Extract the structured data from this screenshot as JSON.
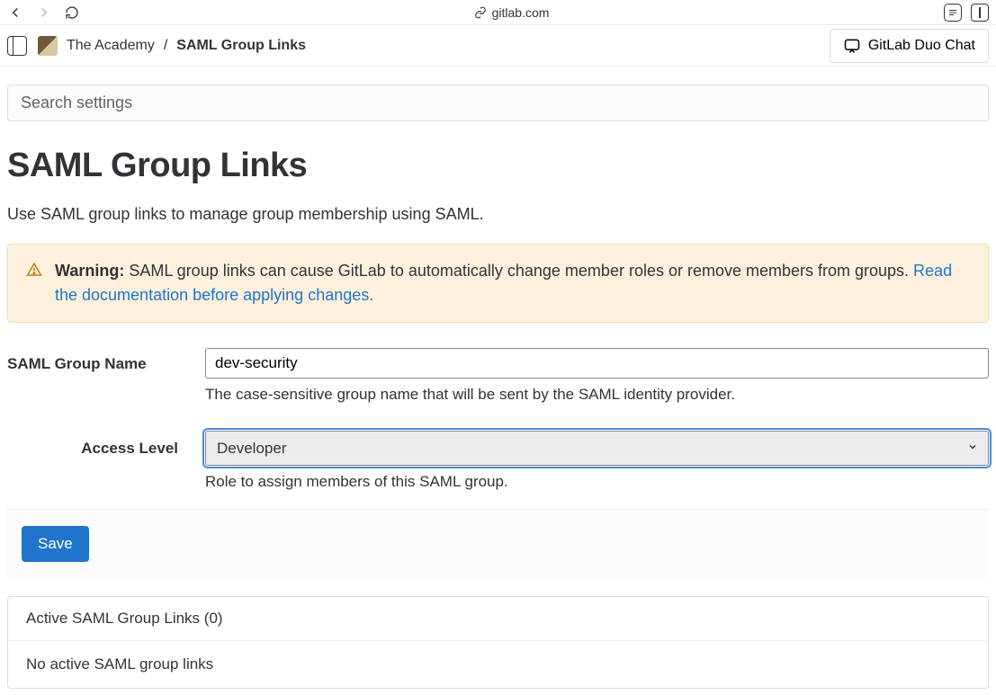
{
  "browser": {
    "domain": "gitlab.com"
  },
  "breadcrumb": {
    "group": "The Academy",
    "sep": "/",
    "current": "SAML Group Links"
  },
  "duo_chat_label": "GitLab Duo Chat",
  "search": {
    "placeholder": "Search settings"
  },
  "page": {
    "title": "SAML Group Links",
    "desc": "Use SAML group links to manage group membership using SAML."
  },
  "alert": {
    "prefix": "Warning:",
    "body": " SAML group links can cause GitLab to automatically change member roles or remove members from groups. ",
    "link": "Read the documentation before applying changes."
  },
  "form": {
    "group_name_label": "SAML Group Name",
    "group_name_value": "dev-security",
    "group_name_help": "The case-sensitive group name that will be sent by the SAML identity provider.",
    "access_level_label": "Access Level",
    "access_level_value": "Developer",
    "access_level_help": "Role to assign members of this SAML group.",
    "save_label": "Save"
  },
  "active": {
    "header": "Active SAML Group Links (0)",
    "empty": "No active SAML group links"
  }
}
